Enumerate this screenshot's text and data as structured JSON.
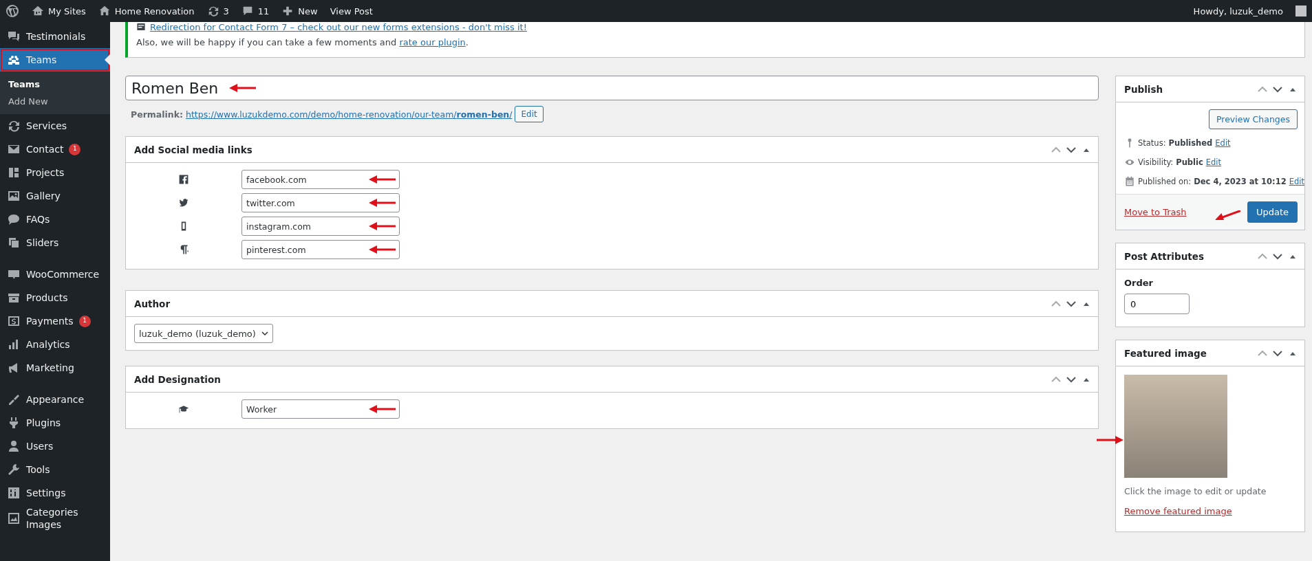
{
  "admin_bar": {
    "items": [
      {
        "label": "My Sites"
      },
      {
        "label": "Home Renovation"
      },
      {
        "label": "3"
      },
      {
        "label": "11"
      },
      {
        "label": "New"
      },
      {
        "label": "View Post"
      }
    ],
    "greeting": "Howdy, luzuk_demo"
  },
  "sidebar": {
    "groups": [
      {
        "items": [
          {
            "label": "Testimonials",
            "selected": false,
            "annotated": false
          },
          {
            "label": "Teams",
            "selected": true,
            "annotated": true,
            "children": [
              {
                "label": "Teams",
                "selected": true
              },
              {
                "label": "Add New",
                "selected": false
              }
            ]
          },
          {
            "label": "Services",
            "selected": false,
            "annotated": false
          },
          {
            "label": "Contact",
            "selected": false,
            "annotated": false,
            "badge": "1"
          },
          {
            "label": "Projects",
            "selected": false,
            "annotated": false
          },
          {
            "label": "Gallery",
            "selected": false,
            "annotated": false
          },
          {
            "label": "FAQs",
            "selected": false,
            "annotated": false
          },
          {
            "label": "Sliders",
            "selected": false,
            "annotated": false
          }
        ]
      },
      {
        "items": [
          {
            "label": "WooCommerce",
            "selected": false,
            "annotated": false
          },
          {
            "label": "Products",
            "selected": false,
            "annotated": false
          },
          {
            "label": "Payments",
            "selected": false,
            "annotated": false,
            "badge": "1"
          },
          {
            "label": "Analytics",
            "selected": false,
            "annotated": false
          },
          {
            "label": "Marketing",
            "selected": false,
            "annotated": false
          }
        ]
      },
      {
        "items": [
          {
            "label": "Appearance",
            "selected": false,
            "annotated": false
          },
          {
            "label": "Plugins",
            "selected": false,
            "annotated": false
          },
          {
            "label": "Users",
            "selected": false,
            "annotated": false
          },
          {
            "label": "Tools",
            "selected": false,
            "annotated": false
          },
          {
            "label": "Settings",
            "selected": false,
            "annotated": false
          },
          {
            "label": "Categories Images",
            "selected": false,
            "annotated": false
          }
        ]
      }
    ]
  },
  "notice": {
    "link_line": "Redirection for Contact Form 7 – check out our new forms extensions - don't miss it!",
    "text": "Also, we will be happy if you can take a few moments and",
    "link": "rate our plugin",
    "text_end": "."
  },
  "title_field": {
    "value": "Romen Ben",
    "annotated": true
  },
  "permalink": {
    "label": "Permalink:",
    "url": "https://www.luzukdemo.com/demo/home-renovation/our-team/**romen-ben**/",
    "button": "Edit"
  },
  "social_box": {
    "title": "Add Social media links",
    "fields": [
      {
        "value": "facebook.com",
        "annotated": true
      },
      {
        "value": "twitter.com",
        "annotated": true
      },
      {
        "value": "instagram.com",
        "annotated": true
      },
      {
        "value": "pinterest.com",
        "annotated": true
      }
    ]
  },
  "author_box": {
    "title": "Author",
    "select": {
      "value": "luzuk_demo (luzuk_demo)"
    }
  },
  "designation_box": {
    "title": "Add Designation",
    "fields": [
      {
        "value": "Worker",
        "annotated": true
      }
    ]
  },
  "publish_box": {
    "title": "Publish",
    "preview_button": "Preview Changes",
    "rows": [
      {
        "label": "Status:",
        "value": "Published",
        "link": "Edit"
      },
      {
        "label": "Visibility:",
        "value": "Public",
        "link": "Edit"
      },
      {
        "label": "Published on:",
        "value": "Dec 4, 2023 at 10:12",
        "link": "Edit"
      }
    ],
    "trash_link": "Move to Trash",
    "update_button": {
      "label": "Update",
      "annotated": true
    }
  },
  "attributes_box": {
    "title": "Post Attributes",
    "order_label": "Order",
    "order_value": "0"
  },
  "featured_box": {
    "title": "Featured image",
    "image_annotated": true,
    "hint": "Click the image to edit or update",
    "remove_link": "Remove featured image"
  }
}
